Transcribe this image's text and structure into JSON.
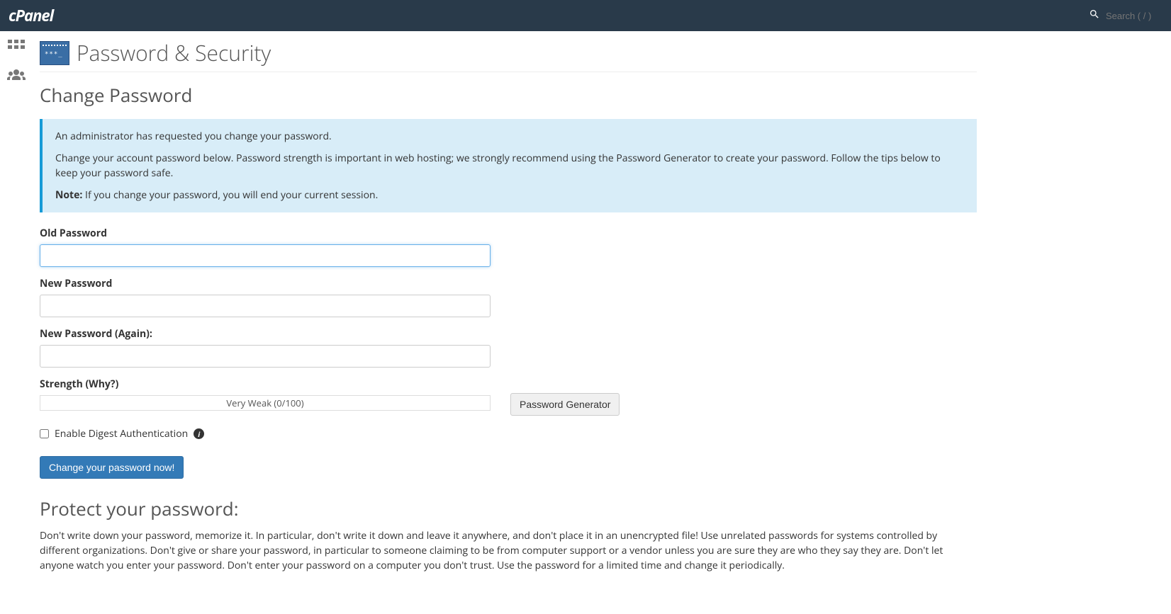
{
  "header": {
    "logo": "cPanel",
    "search_placeholder": "Search ( / )"
  },
  "page": {
    "title": "Password & Security",
    "section_title": "Change Password"
  },
  "info": {
    "line1": "An administrator has requested you change your password.",
    "line2": "Change your account password below. Password strength is important in web hosting; we strongly recommend using the Password Generator to create your password. Follow the tips below to keep your password safe.",
    "note_label": "Note:",
    "note_text": " If you change your password, you will end your current session."
  },
  "form": {
    "old_password_label": "Old Password",
    "new_password_label": "New Password",
    "new_password_again_label": "New Password (Again):",
    "strength_label": "Strength (Why?)",
    "strength_value": "Very Weak (0/100)",
    "generator_button": "Password Generator",
    "digest_label": "Enable Digest Authentication",
    "submit_button": "Change your password now!"
  },
  "protect": {
    "title": "Protect your password:",
    "text": "Don't write down your password, memorize it. In particular, don't write it down and leave it anywhere, and don't place it in an unencrypted file! Use unrelated passwords for systems controlled by different organizations. Don't give or share your password, in particular to someone claiming to be from computer support or a vendor unless you are sure they are who they say they are. Don't let anyone watch you enter your password. Don't enter your password on a computer you don't trust. Use the password for a limited time and change it periodically."
  }
}
